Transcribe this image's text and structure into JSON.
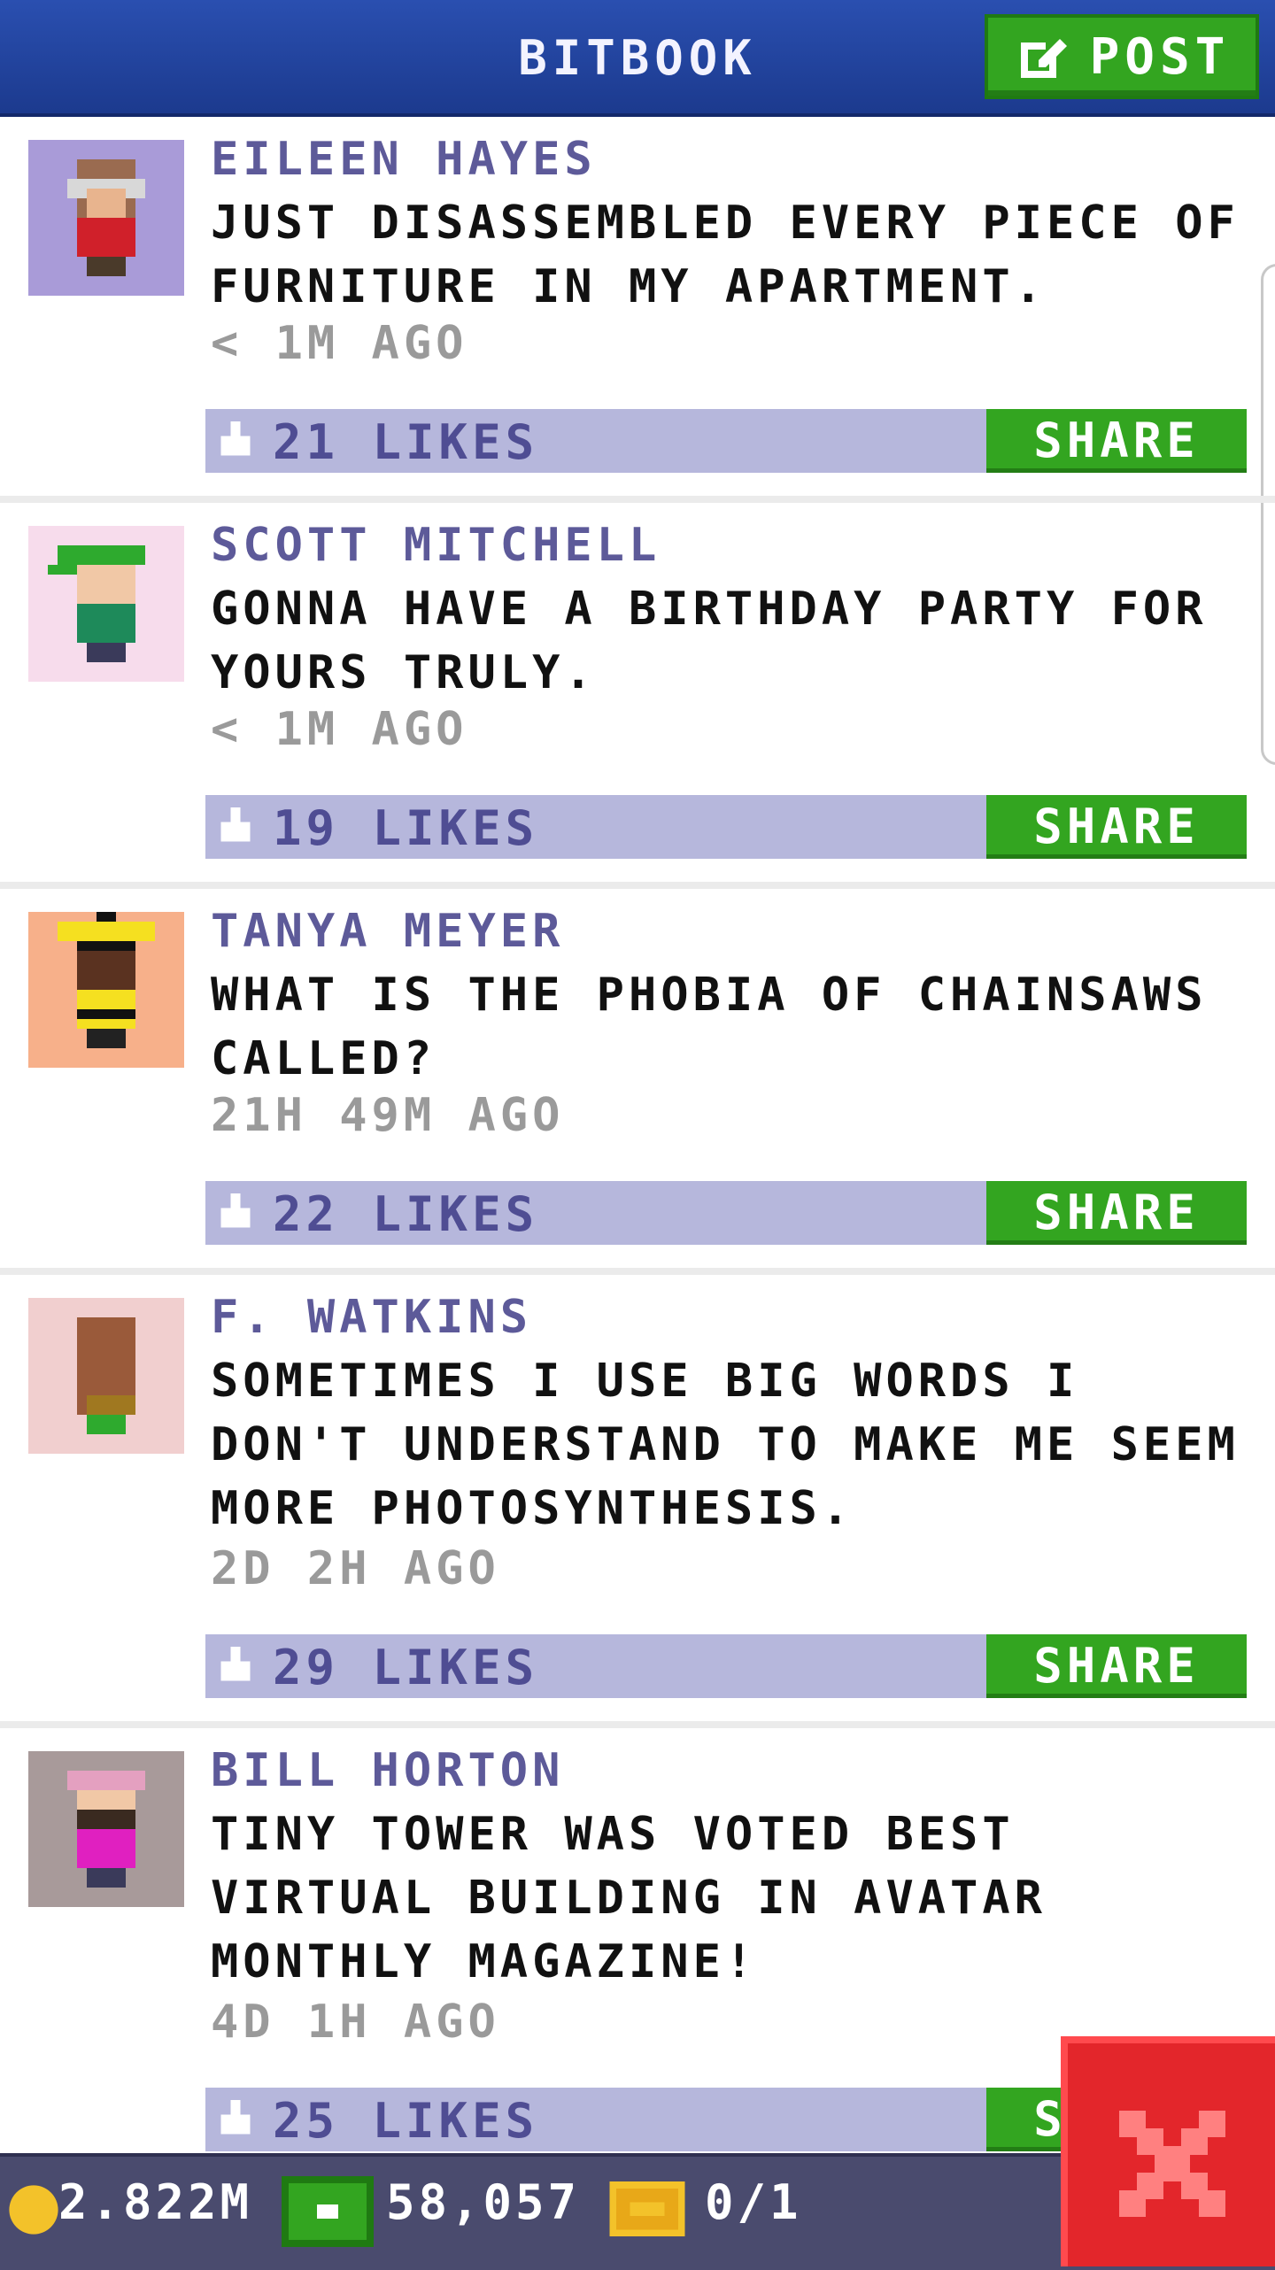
{
  "header": {
    "title": "BITBOOK",
    "post_label": "POST"
  },
  "posts": [
    {
      "author": "EILEEN HAYES",
      "text": "JUST DISASSEMBLED EVERY PIECE OF FURNITURE IN MY APARTMENT.",
      "time": "< 1M AGO",
      "likes": "21 LIKES",
      "share_label": "SHARE",
      "avatar_bg": "#a99bd8"
    },
    {
      "author": "SCOTT MITCHELL",
      "text": "GONNA HAVE A BIRTHDAY PARTY FOR YOURS TRULY.",
      "time": "< 1M AGO",
      "likes": "19 LIKES",
      "share_label": "SHARE",
      "avatar_bg": "#f7dcec"
    },
    {
      "author": "TANYA MEYER",
      "text": "WHAT IS THE PHOBIA OF CHAINSAWS CALLED?",
      "time": "21H 49M AGO",
      "likes": "22 LIKES",
      "share_label": "SHARE",
      "avatar_bg": "#f7b08a"
    },
    {
      "author": "F. WATKINS",
      "text": "SOMETIMES I USE BIG WORDS I DON'T UNDERSTAND TO MAKE ME SEEM MORE PHOTOSYNTHESIS.",
      "time": "2D 2H AGO",
      "likes": "29 LIKES",
      "share_label": "SHARE",
      "avatar_bg": "#f1cfcf"
    },
    {
      "author": "BILL HORTON",
      "text": "TINY TOWER WAS VOTED BEST VIRTUAL BUILDING IN AVATAR MONTHLY MAGAZINE!",
      "time": "4D 1H AGO",
      "likes": "25 LIKES",
      "share_label": "SHARE",
      "avatar_bg": "#a89a9a"
    }
  ],
  "status_bar": {
    "coins": "2.822M",
    "bux": "58,057",
    "tickets": "0/1"
  },
  "colors": {
    "header": "#2a4fb0",
    "green": "#33a520",
    "like_bar": "#b6b7dc",
    "close": "#e3262b"
  }
}
